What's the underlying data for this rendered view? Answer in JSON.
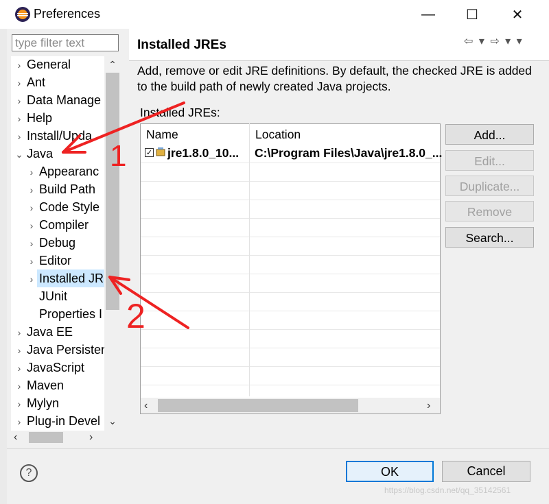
{
  "window": {
    "title": "Preferences",
    "minimize_label": "—",
    "maximize_label": "☐",
    "close_label": "✕"
  },
  "filter": {
    "placeholder": "type filter text",
    "value": ""
  },
  "tree": [
    {
      "label": "General",
      "level": 0,
      "arrow": "›"
    },
    {
      "label": "Ant",
      "level": 0,
      "arrow": "›"
    },
    {
      "label": "Data Manage",
      "level": 0,
      "arrow": "›"
    },
    {
      "label": "Help",
      "level": 0,
      "arrow": "›"
    },
    {
      "label": "Install/Upda",
      "level": 0,
      "arrow": "›"
    },
    {
      "label": "Java",
      "level": 0,
      "arrow": "⌄"
    },
    {
      "label": "Appearanc",
      "level": 1,
      "arrow": "›"
    },
    {
      "label": "Build Path",
      "level": 1,
      "arrow": "›"
    },
    {
      "label": "Code Style",
      "level": 1,
      "arrow": "›"
    },
    {
      "label": "Compiler",
      "level": 1,
      "arrow": "›"
    },
    {
      "label": "Debug",
      "level": 1,
      "arrow": "›"
    },
    {
      "label": "Editor",
      "level": 1,
      "arrow": "›"
    },
    {
      "label": "Installed JR",
      "level": 1,
      "arrow": "›",
      "selected": true
    },
    {
      "label": "JUnit",
      "level": 1,
      "arrow": ""
    },
    {
      "label": "Properties I",
      "level": 1,
      "arrow": ""
    },
    {
      "label": "Java EE",
      "level": 0,
      "arrow": "›"
    },
    {
      "label": "Java Persisten",
      "level": 0,
      "arrow": "›"
    },
    {
      "label": "JavaScript",
      "level": 0,
      "arrow": "›"
    },
    {
      "label": "Maven",
      "level": 0,
      "arrow": "›"
    },
    {
      "label": "Mylyn",
      "level": 0,
      "arrow": "›"
    },
    {
      "label": "Plug-in Devel",
      "level": 0,
      "arrow": "›"
    }
  ],
  "page": {
    "title": "Installed JREs",
    "nav_buttons": "⇦ ▾ ⇨ ▾ ▾",
    "description": "Add, remove or edit JRE definitions. By default, the checked JRE is added to the build path of newly created Java projects.",
    "table_label": "Installed JREs:"
  },
  "table": {
    "columns": [
      "Name",
      "Location"
    ],
    "rows": [
      {
        "checked": true,
        "name": "jre1.8.0_10...",
        "location": "C:\\Program Files\\Java\\jre1.8.0_..."
      }
    ]
  },
  "buttons": {
    "add": "Add...",
    "edit": "Edit...",
    "duplicate": "Duplicate...",
    "remove": "Remove",
    "search": "Search..."
  },
  "footer": {
    "help": "?",
    "ok": "OK",
    "cancel": "Cancel"
  },
  "annotations": {
    "one": "1",
    "two": "2",
    "color": "#ee2222"
  },
  "watermark": "https://blog.csdn.net/qq_35142561"
}
